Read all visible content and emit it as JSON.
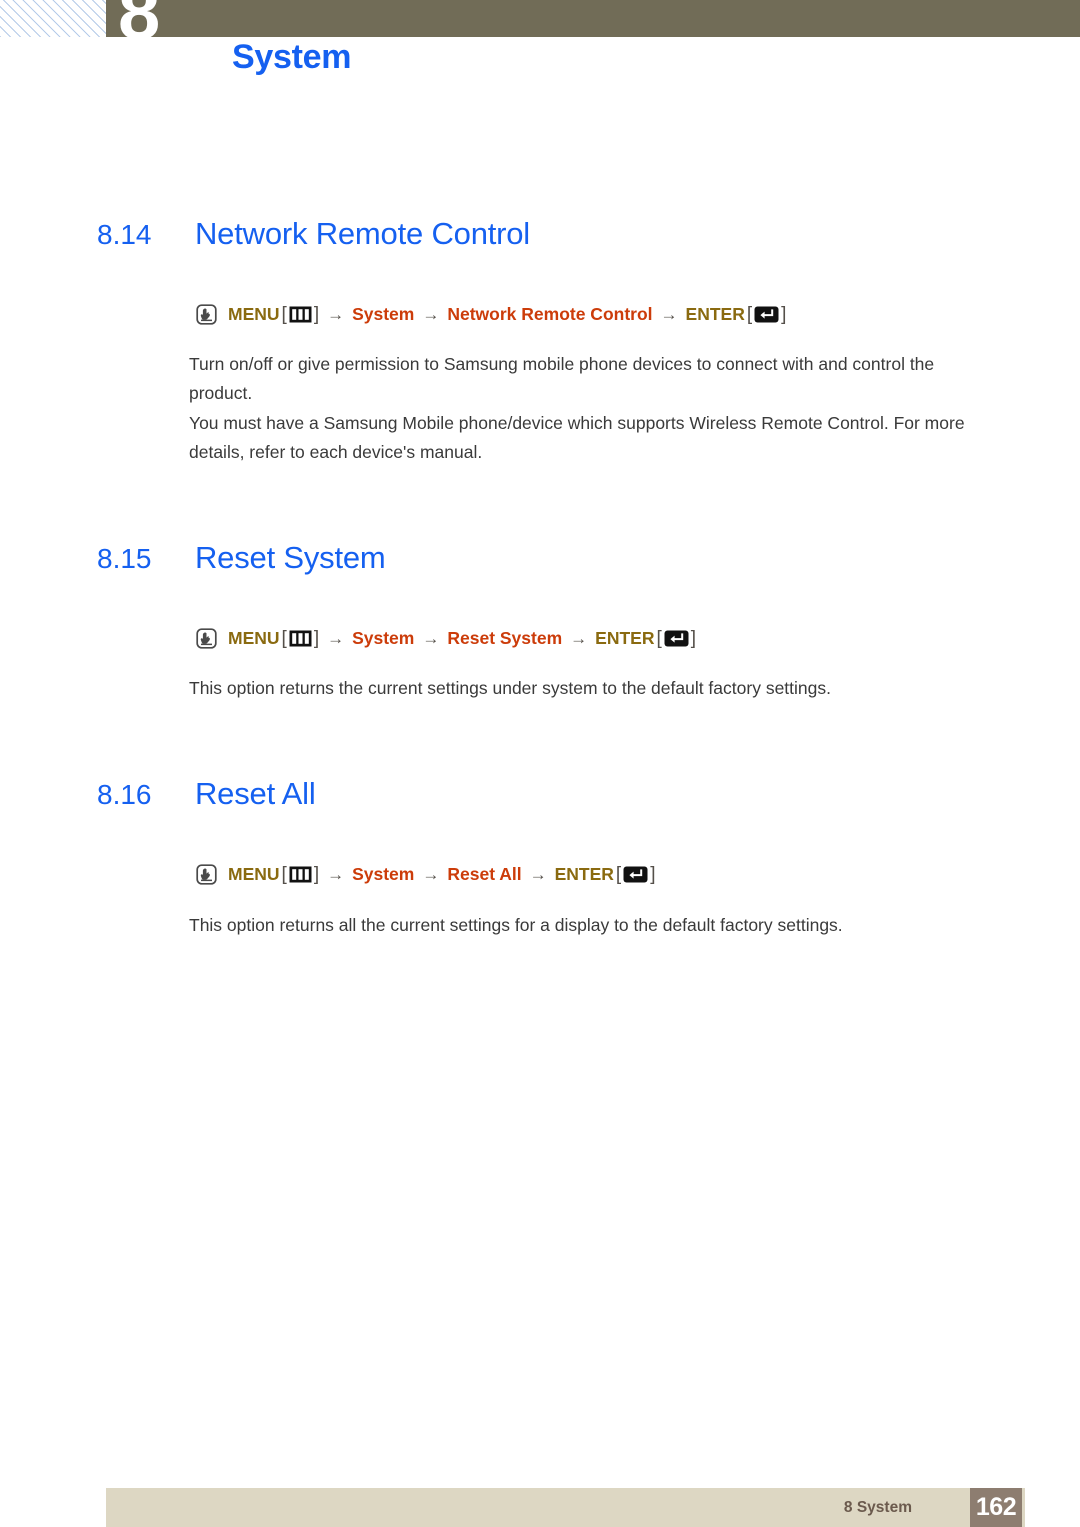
{
  "header": {
    "chapter_number": "8",
    "title": "System",
    "band_color": "#716c57",
    "title_color": "#1560f0"
  },
  "icons": {
    "hand": "hand-press-icon",
    "menu": "menu-bars-icon",
    "enter": "enter-key-icon",
    "arrow": "→",
    "bracket_open": "[",
    "bracket_close": "]"
  },
  "sections": [
    {
      "number": "8.14",
      "title": "Network Remote Control",
      "path": {
        "menu_label": "MENU",
        "items": [
          "System",
          "Network Remote Control"
        ],
        "enter_label": "ENTER"
      },
      "paragraphs": [
        "Turn on/off or give permission to Samsung mobile phone devices to connect with and control the product.",
        "You must have a Samsung Mobile phone/device which supports Wireless Remote Control. For more details, refer to each device's manual."
      ]
    },
    {
      "number": "8.15",
      "title": "Reset System",
      "path": {
        "menu_label": "MENU",
        "items": [
          "System",
          "Reset System"
        ],
        "enter_label": "ENTER"
      },
      "paragraphs": [
        "This option returns the current settings under system to the default factory settings."
      ]
    },
    {
      "number": "8.16",
      "title": "Reset All",
      "path": {
        "menu_label": "MENU",
        "items": [
          "System",
          "Reset All"
        ],
        "enter_label": "ENTER"
      },
      "paragraphs": [
        "This option returns all the current settings for a display to the default factory settings."
      ]
    }
  ],
  "footer": {
    "label": "8 System",
    "page_number": "162",
    "band_color": "#ddd7c3",
    "page_box_color": "#8d7d70"
  },
  "colors": {
    "heading": "#1560f0",
    "menu_gold": "#8a6a10",
    "path_orange": "#cc3c0a",
    "body_text": "#3a3a3a"
  }
}
